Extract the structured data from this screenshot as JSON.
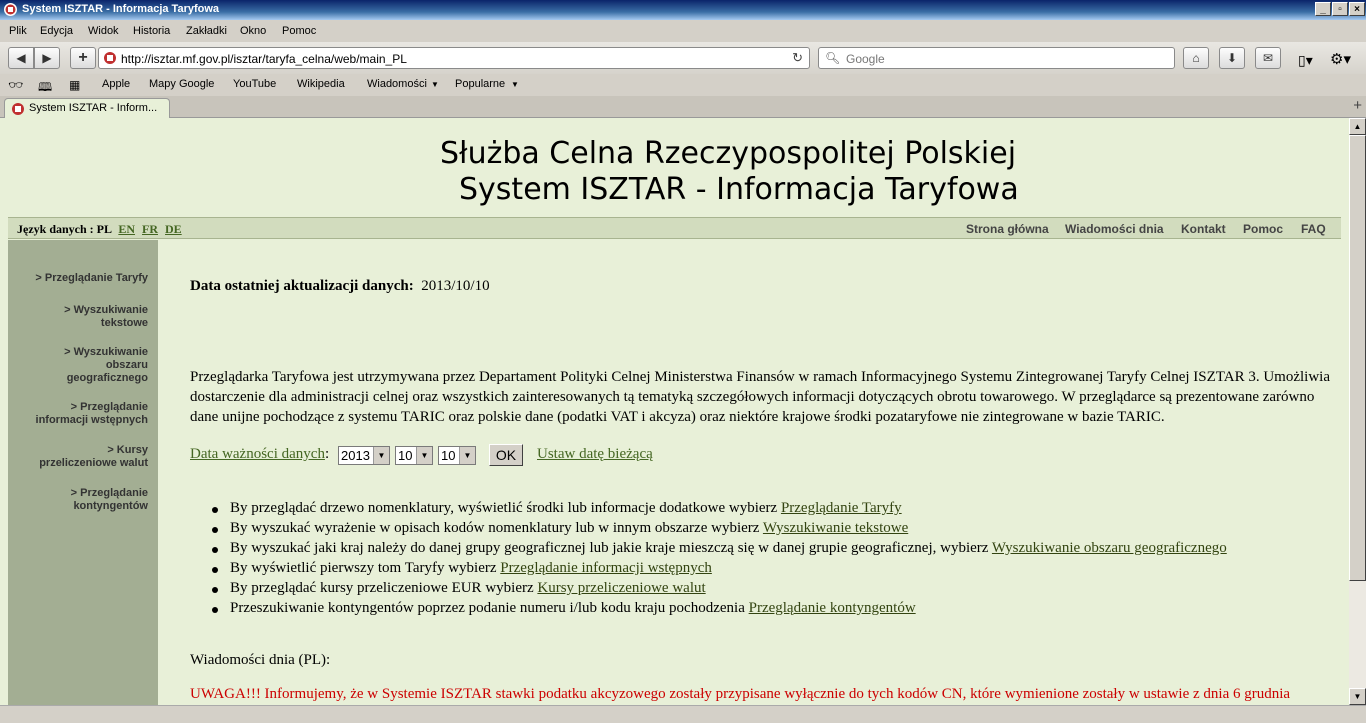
{
  "window": {
    "title": "System ISZTAR - Informacja Taryfowa"
  },
  "menu": [
    "Plik",
    "Edycja",
    "Widok",
    "Historia",
    "Zakładki",
    "Okno",
    "Pomoc"
  ],
  "navbar": {
    "url": "http://isztar.mf.gov.pl/isztar/taryfa_celna/web/main_PL",
    "search_placeholder": "Google"
  },
  "bookmarks": [
    "Apple",
    "Mapy Google",
    "YouTube",
    "Wikipedia",
    "Wiadomości",
    "Popularne"
  ],
  "tab": {
    "title": "System ISZTAR - Inform..."
  },
  "page": {
    "header_line1": "Służba Celna Rzeczypospolitej Polskiej",
    "header_line2": "System ISZTAR - Informacja Taryfowa",
    "lang_label": "Język danych : PL",
    "langs": [
      "EN",
      "FR",
      "DE"
    ],
    "top_links": [
      "Strona główna",
      "Wiadomości dnia",
      "Kontakt",
      "Pomoc",
      "FAQ"
    ],
    "sidebar": [
      {
        "line1": "> Przeglądanie Taryfy",
        "line2": "",
        "line3": ""
      },
      {
        "line1": "> Wyszukiwanie",
        "line2": "tekstowe",
        "line3": ""
      },
      {
        "line1": "> Wyszukiwanie",
        "line2": "obszaru",
        "line3": "geograficznego"
      },
      {
        "line1": "> Przeglądanie",
        "line2": "informacji wstępnych",
        "line3": ""
      },
      {
        "line1": "> Kursy",
        "line2": "przeliczeniowe walut",
        "line3": ""
      },
      {
        "line1": "> Przeglądanie",
        "line2": "kontyngentów",
        "line3": ""
      }
    ],
    "update_label": "Data ostatniej aktualizacji danych:",
    "update_value": "2013/10/10",
    "intro_line1": "Przeglądarka Taryfowa jest utrzymywana przez Departament Polityki Celnej Ministerstwa Finansów w ramach Informacyjnego Systemu Zintegrowanej Taryfy Celnej ISZTAR 3. Umożliwia",
    "intro_line2": "dostarczenie dla administracji celnej oraz wszystkich zainteresowanych tą tematyką szczegółowych informacji dotyczących obrotu towarowego. W przeglądarce są prezentowane zarówno",
    "intro_line3": "dane unijne pochodzące z systemu TARIC oraz polskie dane (podatki VAT i akcyza) oraz niektóre krajowe środki pozataryfowe nie zintegrowane w bazie TARIC.",
    "validity_link": "Data ważności danych",
    "validity_colon": ":",
    "year": "2013",
    "month": "10",
    "day": "10",
    "ok": "OK",
    "set_today": "Ustaw datę bieżącą",
    "bullets": [
      {
        "text": "By przeglądać drzewo nomenklatury, wyświetlić środki lub informacje dodatkowe wybierz",
        "link": "Przeglądanie Taryfy"
      },
      {
        "text": "By wyszukać wyrażenie w opisach kodów nomenklatury lub w innym obszarze wybierz",
        "link": "Wyszukiwanie tekstowe"
      },
      {
        "text": "By wyszukać jaki kraj należy do danej grupy geograficznej lub jakie kraje mieszczą się w danej grupie geograficznej, wybierz",
        "link": "Wyszukiwanie obszaru geograficznego"
      },
      {
        "text": "By wyświetlić pierwszy tom Taryfy wybierz",
        "link": "Przeglądanie informacji wstępnych"
      },
      {
        "text": "By przeglądać kursy przeliczeniowe EUR wybierz",
        "link": "Kursy przeliczeniowe walut"
      },
      {
        "text": "Przeszukiwanie kontyngentów poprzez podanie numeru i/lub kodu kraju pochodzenia",
        "link": "Przeglądanie kontyngentów"
      }
    ],
    "news_label": "Wiadomości dnia (PL):",
    "warning": "UWAGA!!! Informujemy, że w Systemie ISZTAR stawki podatku akcyzowego zostały przypisane wyłącznie do tych kodów CN, które wymienione zostały w ustawie z dnia 6 grudnia"
  }
}
